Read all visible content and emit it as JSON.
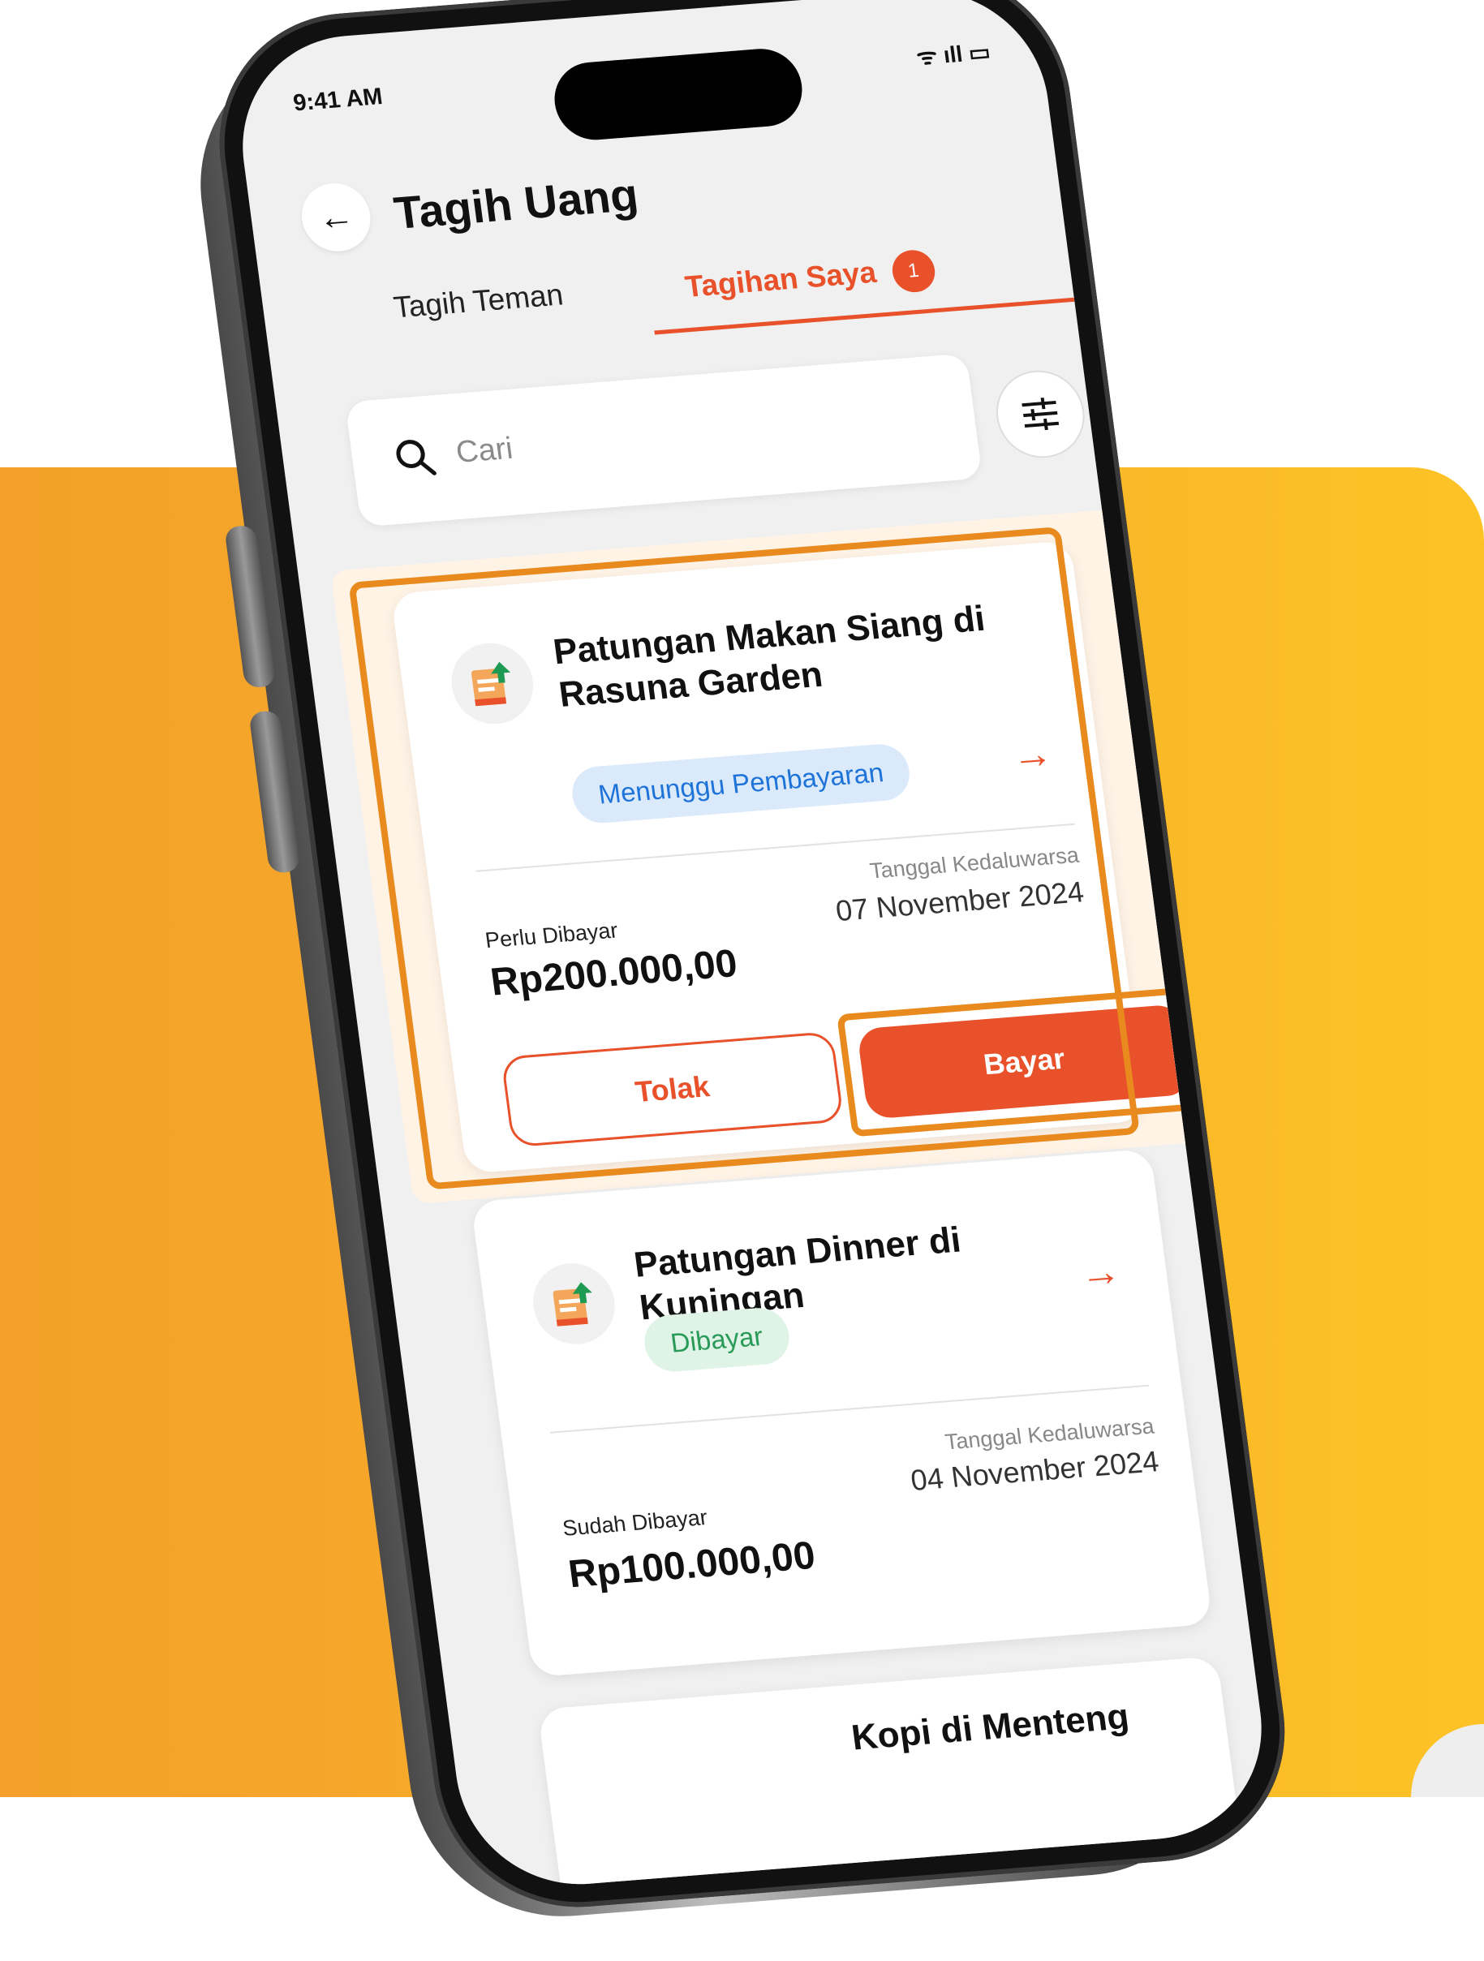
{
  "status_bar": {
    "time": "9:41 AM",
    "icons": "ᯤ ıll ▭"
  },
  "header": {
    "back_icon": "←",
    "title": "Tagih Uang"
  },
  "tabs": [
    {
      "label": "Tagih Teman"
    },
    {
      "label": "Tagihan Saya",
      "badge": "1"
    }
  ],
  "search": {
    "placeholder": "Cari"
  },
  "cards": [
    {
      "title": "Patungan Makan Siang di Rasuna Garden",
      "status": "Menunggu Pembayaran",
      "amount_label": "Perlu Dibayar",
      "amount": "Rp200.000,00",
      "date_label": "Tanggal Kedaluwarsa",
      "date": "07 November 2024",
      "reject_label": "Tolak",
      "pay_label": "Bayar",
      "arrow": "→"
    },
    {
      "title": "Patungan Dinner di Kuningan",
      "status": "Dibayar",
      "amount_label": "Sudah Dibayar",
      "amount": "Rp100.000,00",
      "date_label": "Tanggal Kedaluwarsa",
      "date": "04 November 2024",
      "arrow": "→"
    },
    {
      "title": "Kopi di Menteng"
    }
  ],
  "colors": {
    "accent": "#e8512a",
    "highlight_outline": "#e98a1f",
    "background_orange": "#f7ae2a",
    "pill_blue_text": "#1d73d8",
    "pill_green_text": "#2a9a58"
  }
}
